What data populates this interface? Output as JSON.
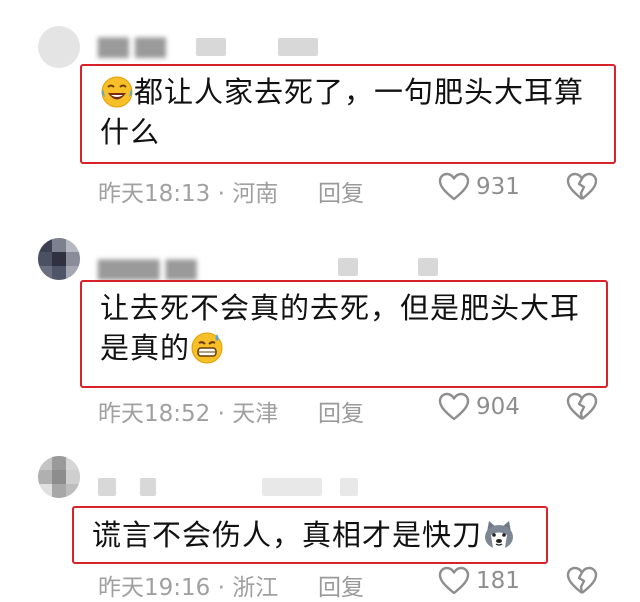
{
  "comments": [
    {
      "text": "都让人家去死了，一句肥头大耳算什么",
      "emoji": "laugh-crying-emoji",
      "emoji_position": "start",
      "time": "昨天18:13",
      "location": "河南",
      "reply_label": "回复",
      "likes": "931"
    },
    {
      "text": "让去死不会真的去死，但是肥头大耳是真的",
      "emoji": "grin-sweat-emoji",
      "emoji_position": "end",
      "time": "昨天18:52",
      "location": "天津",
      "reply_label": "回复",
      "likes": "904"
    },
    {
      "text": "谎言不会伤人，真相才是快刀",
      "emoji": "husky-dog-emoji",
      "emoji_position": "end",
      "time": "昨天19:16",
      "location": "浙江",
      "reply_label": "回复",
      "likes": "181"
    }
  ],
  "colors": {
    "highlight_border": "#d9232a",
    "meta_text": "#a0a0a0"
  }
}
